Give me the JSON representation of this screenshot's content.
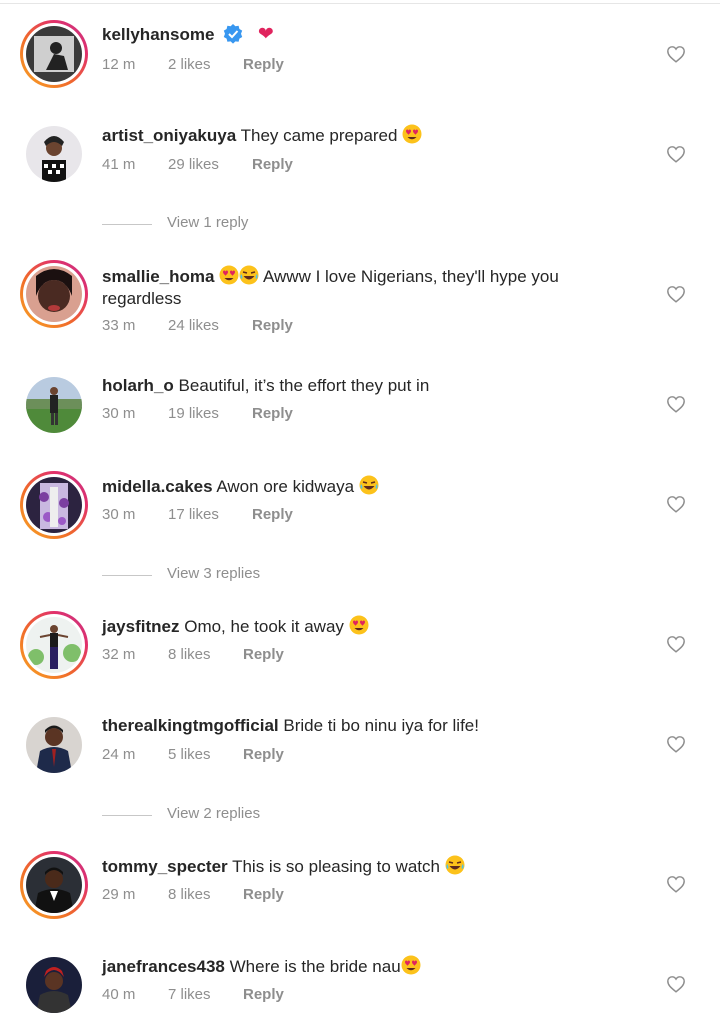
{
  "comments": [
    {
      "username": "kellyhansome",
      "verified": true,
      "text": "❤",
      "time": "12 m",
      "likes": "2 likes",
      "reply": "Reply",
      "story_ring": true
    },
    {
      "username": "artist_oniyakuya",
      "text": "They came prepared",
      "emoji": "heart-eyes",
      "time": "41 m",
      "likes": "29 likes",
      "reply": "Reply",
      "story_ring": false
    },
    {
      "username": "smallie_homa",
      "text": "Awww I love Nigerians, they'll hype you",
      "text2": "regardless",
      "emojis_before": [
        "heart-eyes",
        "laughing"
      ],
      "time": "33 m",
      "likes": "24 likes",
      "reply": "Reply",
      "story_ring": true
    },
    {
      "username": "holarh_o",
      "text": "Beautiful, it’s the effort they put in",
      "time": "30 m",
      "likes": "19 likes",
      "reply": "Reply",
      "story_ring": false
    },
    {
      "username": "midella.cakes",
      "text": "Awon ore kidwaya",
      "emoji": "laughing",
      "time": "30 m",
      "likes": "17 likes",
      "reply": "Reply",
      "story_ring": true
    },
    {
      "username": "jaysfitnez",
      "text": "Omo, he took it away",
      "emoji": "heart-eyes",
      "time": "32 m",
      "likes": "8 likes",
      "reply": "Reply",
      "story_ring": true
    },
    {
      "username": "therealkingtmgofficial",
      "text": "Bride ti bo ninu iya for life!",
      "time": "24 m",
      "likes": "5 likes",
      "reply": "Reply",
      "story_ring": false
    },
    {
      "username": "tommy_specter",
      "text": "This is so pleasing to watch",
      "emoji": "laughing",
      "time": "29 m",
      "likes": "8 likes",
      "reply": "Reply",
      "story_ring": true
    },
    {
      "username": "janefrances438",
      "text": "Where is the bride nau",
      "emoji": "heart-eyes",
      "time": "40 m",
      "likes": "7 likes",
      "reply": "Reply",
      "story_ring": false
    }
  ],
  "view_replies": [
    "View 1 reply",
    "View 3 replies",
    "View 2 replies"
  ],
  "colors": {
    "meta_text": "#8e8e8e",
    "primary_text": "#262626",
    "verified_blue": "#3897f0",
    "heart_red": "#e0245e"
  },
  "icons": {
    "like": "heart-outline-icon",
    "verified": "verified-badge-icon"
  }
}
